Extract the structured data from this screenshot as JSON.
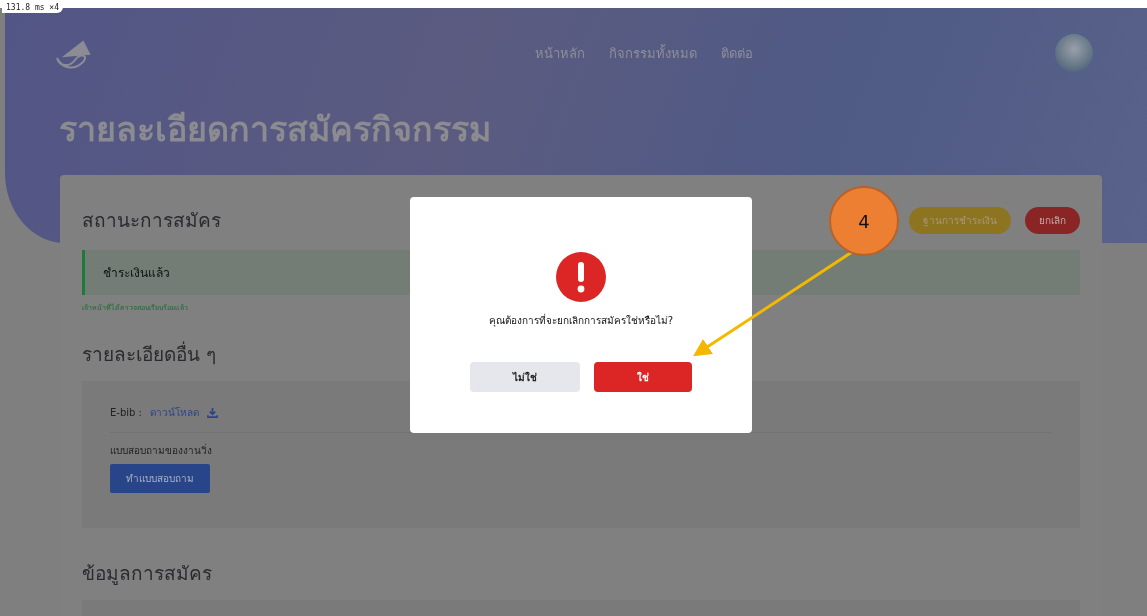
{
  "timing_badge": "131.8 ms ×4",
  "nav": {
    "links": [
      "หน้าหลัก",
      "กิจกรรมทั้งหมด",
      "ติดต่อ"
    ]
  },
  "page_title": "รายละเอียดการสมัครกิจกรรม",
  "status_section": {
    "heading": "สถานะการสมัคร",
    "status": "ชำระเงินแล้ว",
    "note": "เจ้าหน้าที่ได้ตรวจสอบเรียบร้อยแล้ว",
    "actions": [
      {
        "label": "ฐานการชำระเงิน",
        "kind": "proof"
      },
      {
        "label": "ยกเลิก",
        "kind": "cancel"
      }
    ]
  },
  "other_details": {
    "heading": "รายละเอียดอื่น ๆ",
    "ebib_label": "E-bib :",
    "ebib_link": "ดาวน์โหลด",
    "survey_label": "แบบสอบถามของงานวิ่ง",
    "survey_button": "ทำแบบสอบถาม"
  },
  "registration_info": {
    "heading": "ข้อมูลการสมัคร"
  },
  "dialog": {
    "message": "คุณต้องการที่จะยกเลิกการสมัครใช่หรือไม่?",
    "buttons": [
      {
        "label": "ไม่ใช่",
        "kind": "secondary"
      },
      {
        "label": "ใช่",
        "kind": "primary"
      }
    ]
  },
  "callout": {
    "number": "4"
  }
}
